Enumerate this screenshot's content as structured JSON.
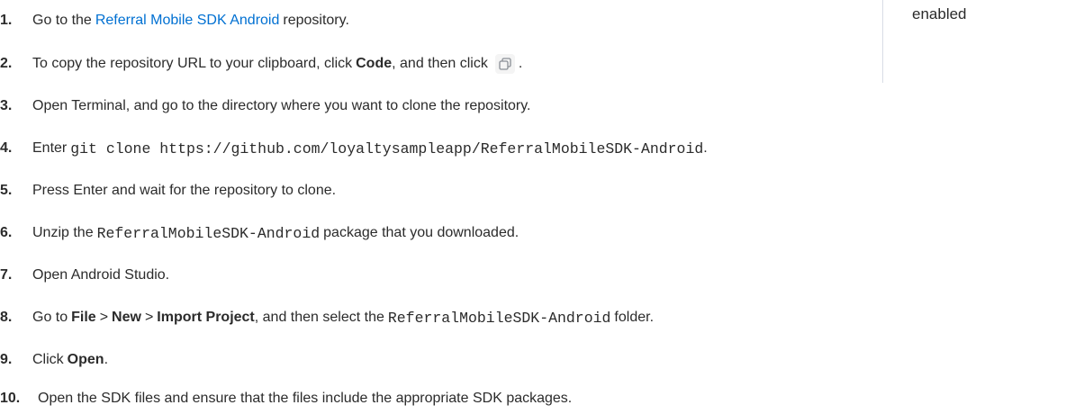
{
  "side": {
    "text": "enabled"
  },
  "steps": {
    "s1": {
      "number": "1.",
      "pre": "Go to the",
      "link": "Referral Mobile SDK Android",
      "post": "repository."
    },
    "s2": {
      "number": "2.",
      "pre": "To copy the repository URL to your clipboard, click",
      "bold": "Code",
      "mid": ", and then click",
      "icon": "copy-icon",
      "post": "."
    },
    "s3": {
      "number": "3.",
      "text": "Open Terminal, and go to the directory where you want to clone the repository."
    },
    "s4": {
      "number": "4.",
      "pre": "Enter",
      "code": "git clone https://github.com/loyaltysampleapp/ReferralMobileSDK-Android",
      "post": "."
    },
    "s5": {
      "number": "5.",
      "text": "Press Enter and wait for the repository to clone."
    },
    "s6": {
      "number": "6.",
      "pre": "Unzip the",
      "code": "ReferralMobileSDK-Android",
      "post": "package that you downloaded."
    },
    "s7": {
      "number": "7.",
      "text": "Open Android Studio."
    },
    "s8": {
      "number": "8.",
      "pre": "Go to",
      "b1": "File",
      "sep1": ">",
      "b2": "New",
      "sep2": ">",
      "b3": "Import Project",
      "mid": ", and then select the",
      "code": "ReferralMobileSDK-Android",
      "post": "folder."
    },
    "s9": {
      "number": "9.",
      "pre": "Click",
      "bold": "Open",
      "post": "."
    },
    "s10": {
      "number": "10.",
      "text": "Open the SDK files and ensure that the files include the appropriate SDK packages."
    }
  }
}
